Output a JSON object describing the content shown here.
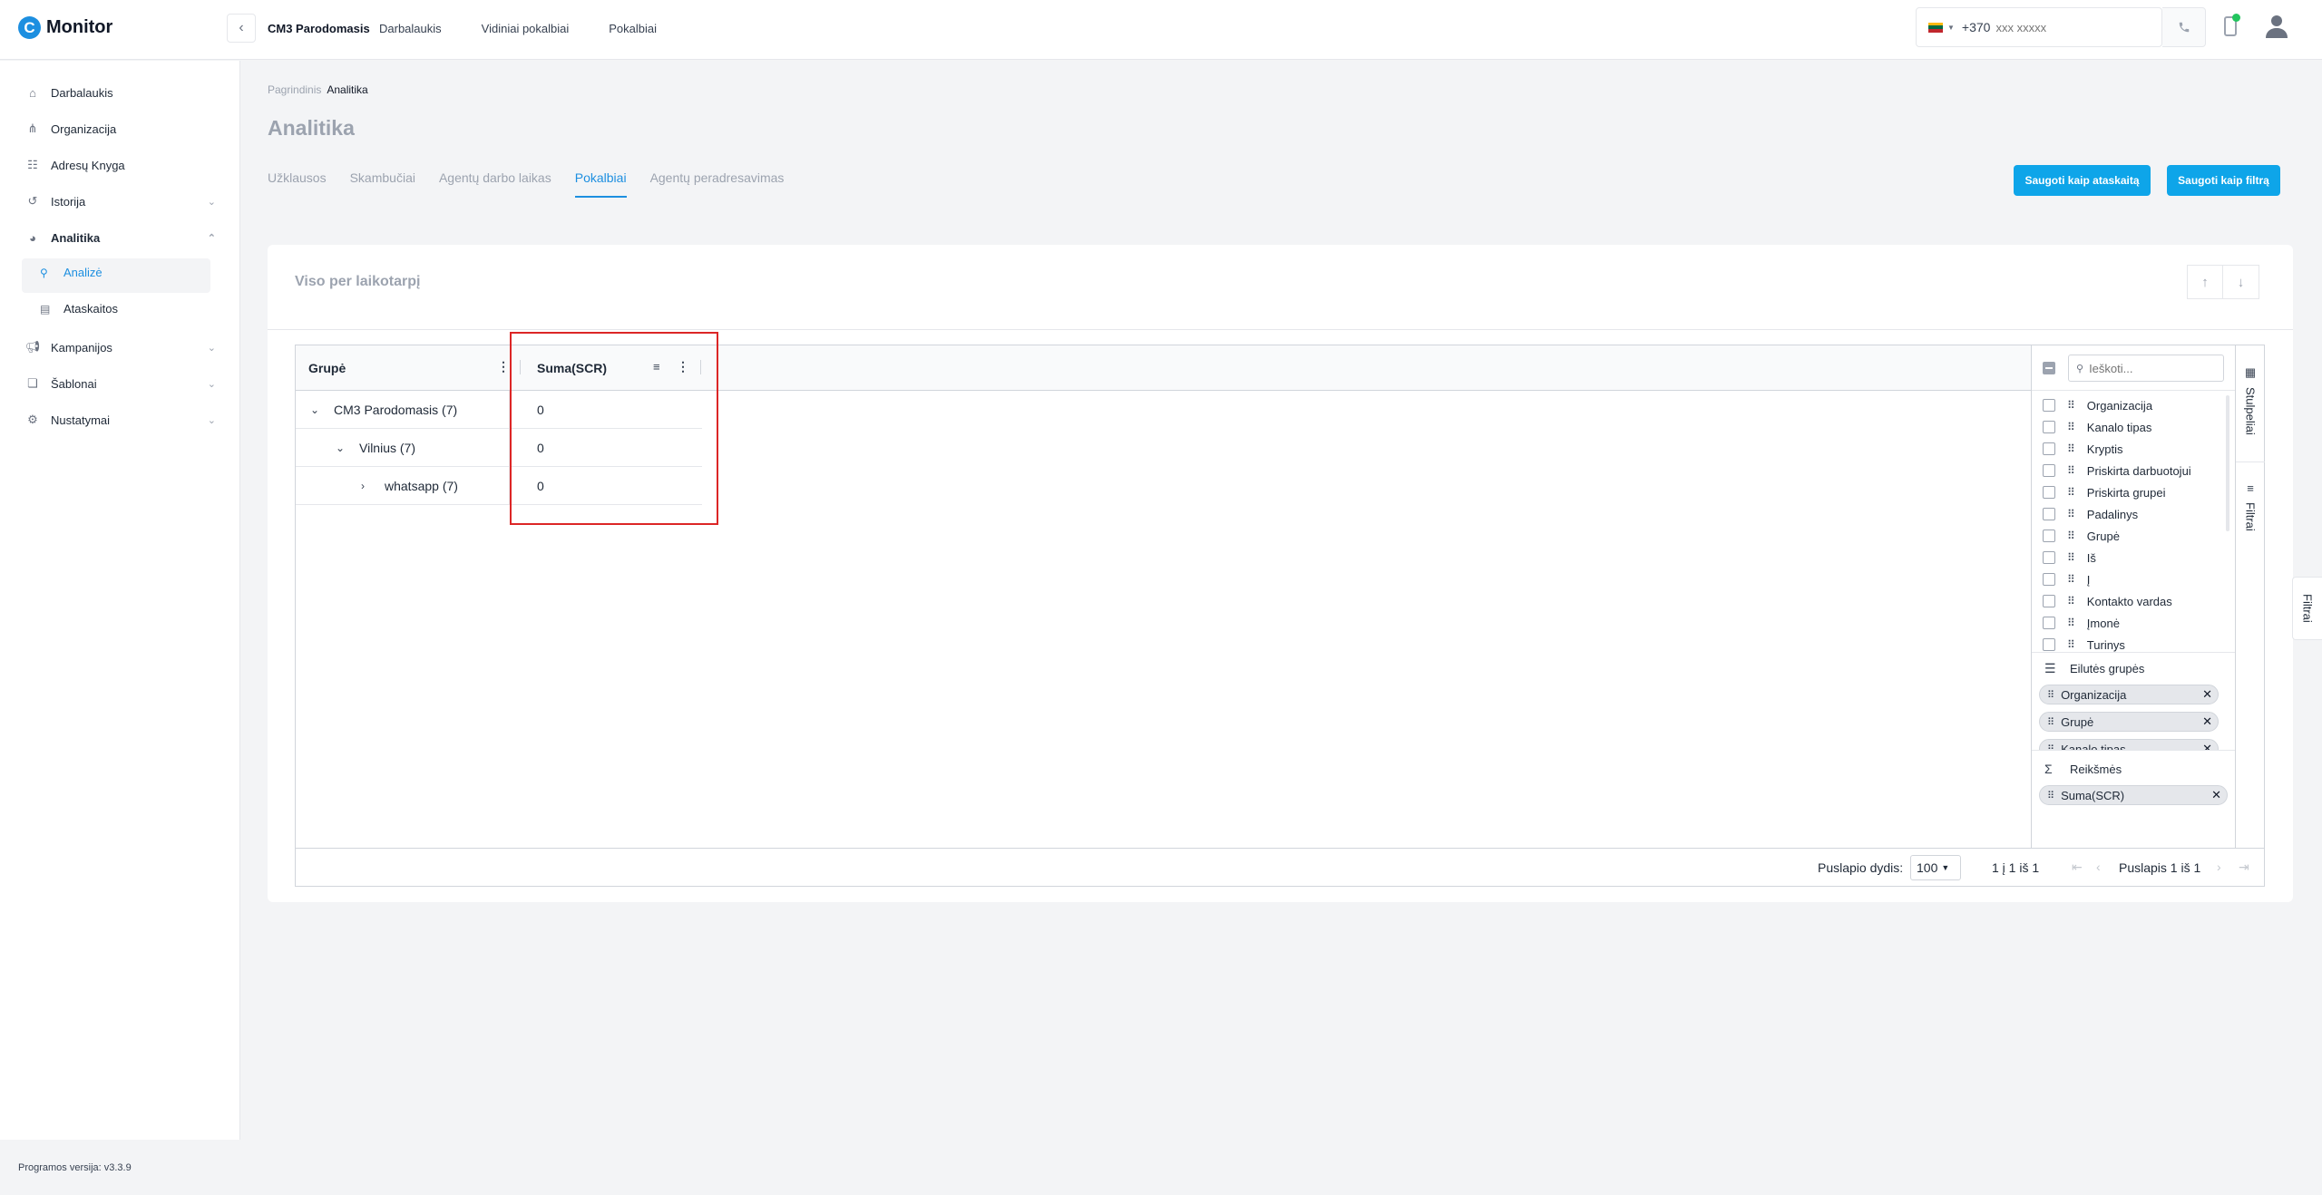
{
  "app": {
    "logo_letter": "C",
    "logo_text": "Monitor",
    "version": "Programos versija: v3.3.9"
  },
  "topbar": {
    "tenant": "CM3 Parodomasis",
    "nav": [
      "Darbalaukis",
      "Vidiniai pokalbiai",
      "Pokalbiai"
    ],
    "phone_prefix": "+370",
    "phone_placeholder": "xxx xxxxx",
    "flag_colors": [
      "#FDB913",
      "#006A44",
      "#C1272D"
    ],
    "device_status_color": "#22c55e"
  },
  "sidebar": {
    "items": [
      {
        "label": "Darbalaukis",
        "icon": "home-icon"
      },
      {
        "label": "Organizacija",
        "icon": "org-icon"
      },
      {
        "label": "Adresų Knyga",
        "icon": "contacts-icon"
      },
      {
        "label": "Istorija",
        "icon": "history-icon"
      },
      {
        "label": "Analitika",
        "icon": "analytics-icon"
      },
      {
        "label": "Kampanijos",
        "icon": "megaphone-icon"
      },
      {
        "label": "Šablonai",
        "icon": "template-icon"
      },
      {
        "label": "Nustatymai",
        "icon": "gear-icon"
      }
    ],
    "sub_items": [
      {
        "label": "Analizė",
        "icon": "search-icon"
      },
      {
        "label": "Ataskaitos",
        "icon": "document-icon"
      }
    ]
  },
  "main": {
    "breadcrumb": [
      "Pagrindinis",
      "Analitika"
    ],
    "title": "Analitika",
    "tabs": [
      "Užklausos",
      "Skambučiai",
      "Agentų darbo laikas",
      "Pokalbiai",
      "Agentų peradresavimas"
    ],
    "active_tab": "Pokalbiai",
    "buttons": {
      "save_report": "Saugoti kaip ataskaitą",
      "save_filter": "Saugoti kaip filtrą"
    },
    "accent_color": "#1d8fe0"
  },
  "card": {
    "title": "Viso per laikotarpį",
    "grid": {
      "headers": [
        "Grupė",
        "Suma(SCR)"
      ],
      "rows": [
        {
          "label": "CM3 Parodomasis (7)",
          "value": "0",
          "expanded": true
        },
        {
          "label": "Vilnius (7)",
          "value": "0",
          "expanded": true
        },
        {
          "label": "whatsapp (7)",
          "value": "0",
          "expanded": false
        }
      ]
    },
    "tool_panel": {
      "search_placeholder": "Ieškoti...",
      "columns": [
        "Organizacija",
        "Kanalo tipas",
        "Kryptis",
        "Priskirta darbuotojui",
        "Priskirta grupei",
        "Padalinys",
        "Grupė",
        "Iš",
        "Į",
        "Kontakto vardas",
        "Įmonė",
        "Turinys"
      ],
      "row_groups_title": "Eilutės grupės",
      "row_groups": [
        "Organizacija",
        "Grupė",
        "Kanalo tipas"
      ],
      "values_title": "Reikšmės",
      "values": [
        "Suma(SCR)"
      ],
      "side_tabs": [
        "Stulpeliai",
        "Filtrai"
      ]
    },
    "pager": {
      "page_size_label": "Puslapio dydis:",
      "page_size": "100",
      "range": "1 į 1 iš 1",
      "page": "Puslapis 1 iš 1"
    }
  },
  "floating_filter": "Filtrai"
}
